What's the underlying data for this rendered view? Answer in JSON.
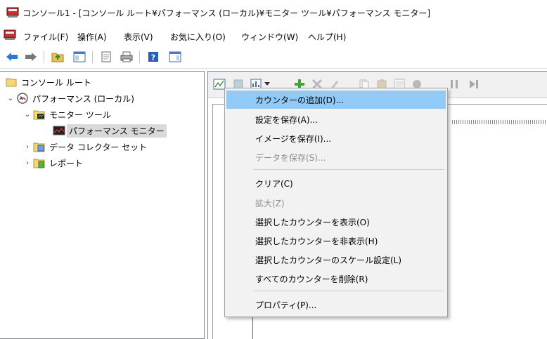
{
  "window": {
    "title": "コンソール1 - [コンソール ルート¥パフォーマンス (ローカル)¥モニター ツール¥パフォーマンス モニター]"
  },
  "menubar": {
    "items": [
      "ファイル(F)",
      "操作(A)",
      "表示(V)",
      "お気に入り(O)",
      "ウィンドウ(W)",
      "ヘルプ(H)"
    ]
  },
  "toolbar": {
    "buttons": [
      "back-icon",
      "forward-icon",
      "up-folder-icon",
      "show-tree-icon",
      "properties-icon",
      "print-icon",
      "help-icon",
      "action-pane-icon"
    ]
  },
  "tree": {
    "root": "コンソール ルート",
    "performance": "パフォーマンス (ローカル)",
    "monitor_tools": "モニター ツール",
    "performance_monitor": "パフォーマンス モニター",
    "data_collector_sets": "データ コレクター セット",
    "reports": "レポート"
  },
  "context_menu": {
    "add_counters": "カウンターの追加(D)...",
    "save_settings": "設定を保存(A)...",
    "save_image": "イメージを保存(I)...",
    "save_data": "データを保存(S)...",
    "clear": "クリア(C)",
    "zoom": "拡大(Z)",
    "show_selected": "選択したカウンターを表示(O)",
    "hide_selected": "選択したカウンターを非表示(H)",
    "scale_selected": "選択したカウンターのスケール設定(L)",
    "remove_all": "すべてのカウンターを削除(R)",
    "properties": "プロパティ(P)..."
  },
  "colors": {
    "highlight": "#91c9f7",
    "menu_bg": "#f2f2f2",
    "add_green": "#3aa63a"
  }
}
